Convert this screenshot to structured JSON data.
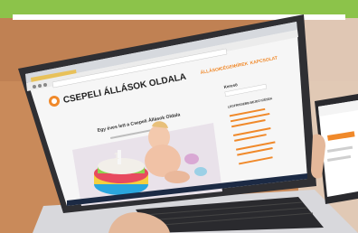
{
  "scene": {
    "top_band_color": "#8cc34a",
    "desk_color": "#c98a5a",
    "laptop_body_color": "#2f2f33"
  },
  "site": {
    "title": "CSEPELI ÁLLÁSOK OLDALA",
    "nav": [
      "ÁLLÁSOK",
      "CÉGEK",
      "HÍREK",
      "KAPCSOLAT"
    ],
    "post_title": "Egy éves lett a Csepeli Állások Oldala",
    "sidebar_heading": "Kereső",
    "sidebar_subheading": "LEGFRISSEBB BEJEGYZÉSEK",
    "accent_color": "#f0892a"
  },
  "browser": {
    "tab_color": "#e8c15a"
  },
  "cake": {
    "candle_label": "1"
  },
  "icons": [
    "site-logo-icon",
    "browser-back-icon",
    "browser-forward-icon",
    "browser-reload-icon"
  ]
}
